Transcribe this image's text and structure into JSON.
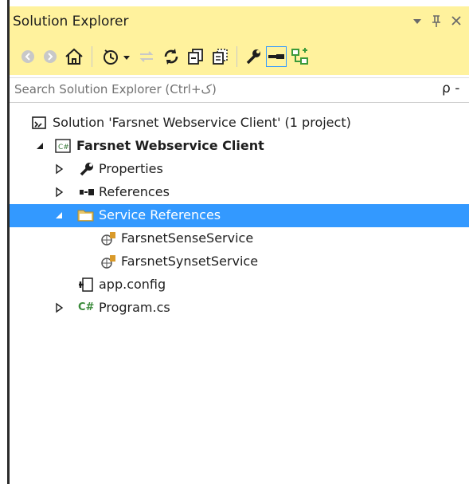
{
  "panel": {
    "title": "Solution Explorer",
    "controls": {
      "dropdown": "▾",
      "pin": "ᵖ",
      "close": "✕"
    }
  },
  "search": {
    "placeholder": "Search Solution Explorer (Ctrl+ک)",
    "icon": "ρ -"
  },
  "tree": {
    "solution": {
      "label": "Solution 'Farsnet Webservice Client' (1 project)"
    },
    "project": {
      "label": "Farsnet Webservice Client",
      "badge": "C#"
    },
    "items": [
      {
        "label": "Properties"
      },
      {
        "label": "References"
      },
      {
        "label": "Service References"
      },
      {
        "label": "FarsnetSenseService"
      },
      {
        "label": "FarsnetSynsetService"
      },
      {
        "label": "app.config"
      },
      {
        "label": "Program.cs",
        "badge": "C#"
      }
    ]
  },
  "colors": {
    "accent": "#fff29d",
    "selection": "#3399ff"
  }
}
